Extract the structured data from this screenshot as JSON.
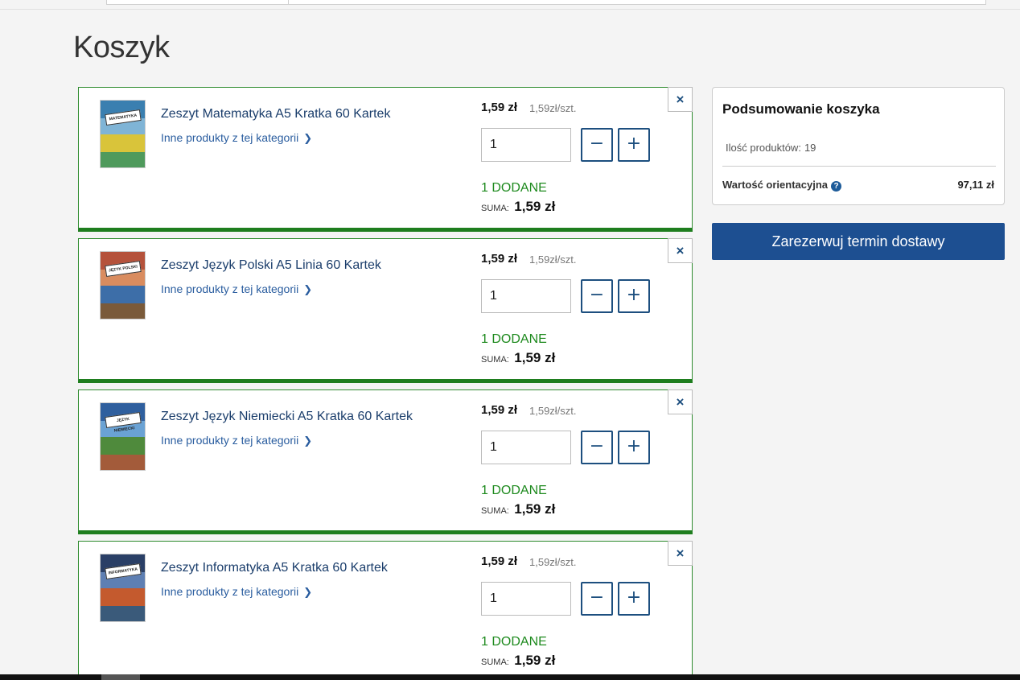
{
  "page": {
    "title": "Koszyk"
  },
  "items": [
    {
      "name": "Zeszyt Matematyka A5 Kratka 60 Kartek",
      "other_link": "Inne produkty z tej kategorii",
      "price": "1,59 zł",
      "unit_price": "1,59zł/szt.",
      "quantity": "1",
      "added": "1 DODANE",
      "sum_label": "SUMA:",
      "sum_value": "1,59 zł",
      "thumb_label": "MATEMATYKA",
      "thumb_colors": [
        "#3a7fb0",
        "#7fb4d6",
        "#d9c43a",
        "#4f9a5c"
      ]
    },
    {
      "name": "Zeszyt Język Polski A5 Linia 60 Kartek",
      "other_link": "Inne produkty z tej kategorii",
      "price": "1,59 zł",
      "unit_price": "1,59zł/szt.",
      "quantity": "1",
      "added": "1 DODANE",
      "sum_label": "SUMA:",
      "sum_value": "1,59 zł",
      "thumb_label": "JĘZYK POLSKI",
      "thumb_colors": [
        "#b5523b",
        "#d98c5f",
        "#3d6ea8",
        "#7a5a3a"
      ]
    },
    {
      "name": "Zeszyt Język Niemiecki A5 Kratka 60 Kartek",
      "other_link": "Inne produkty z tej kategorii",
      "price": "1,59 zł",
      "unit_price": "1,59zł/szt.",
      "quantity": "1",
      "added": "1 DODANE",
      "sum_label": "SUMA:",
      "sum_value": "1,59 zł",
      "thumb_label": "JĘZYK NIEMIECKI",
      "thumb_colors": [
        "#2f5f9e",
        "#6aa2d4",
        "#4f8a3c",
        "#a35b3a"
      ]
    },
    {
      "name": "Zeszyt Informatyka A5 Kratka 60 Kartek",
      "other_link": "Inne produkty z tej kategorii",
      "price": "1,59 zł",
      "unit_price": "1,59zł/szt.",
      "quantity": "1",
      "added": "1 DODANE",
      "sum_label": "SUMA:",
      "sum_value": "1,59 zł",
      "thumb_label": "INFORMATYKA",
      "thumb_colors": [
        "#2a3f66",
        "#5e7fb3",
        "#c45a2e",
        "#3a5a7a"
      ]
    }
  ],
  "controls": {
    "minus_symbol": "−",
    "plus_symbol": "+",
    "remove_symbol": "×",
    "chevron": "❯"
  },
  "summary": {
    "title": "Podsumowanie koszyka",
    "count_label": "Ilość produktów:",
    "count_value": "19",
    "value_label": "Wartość orientacyjna",
    "help": "?",
    "value": "97,11 zł"
  },
  "actions": {
    "reserve_label": "Zarezerwuj termin dostawy"
  },
  "colors": {
    "brand_blue": "#1d4f91",
    "success_green": "#1e8a1e"
  }
}
